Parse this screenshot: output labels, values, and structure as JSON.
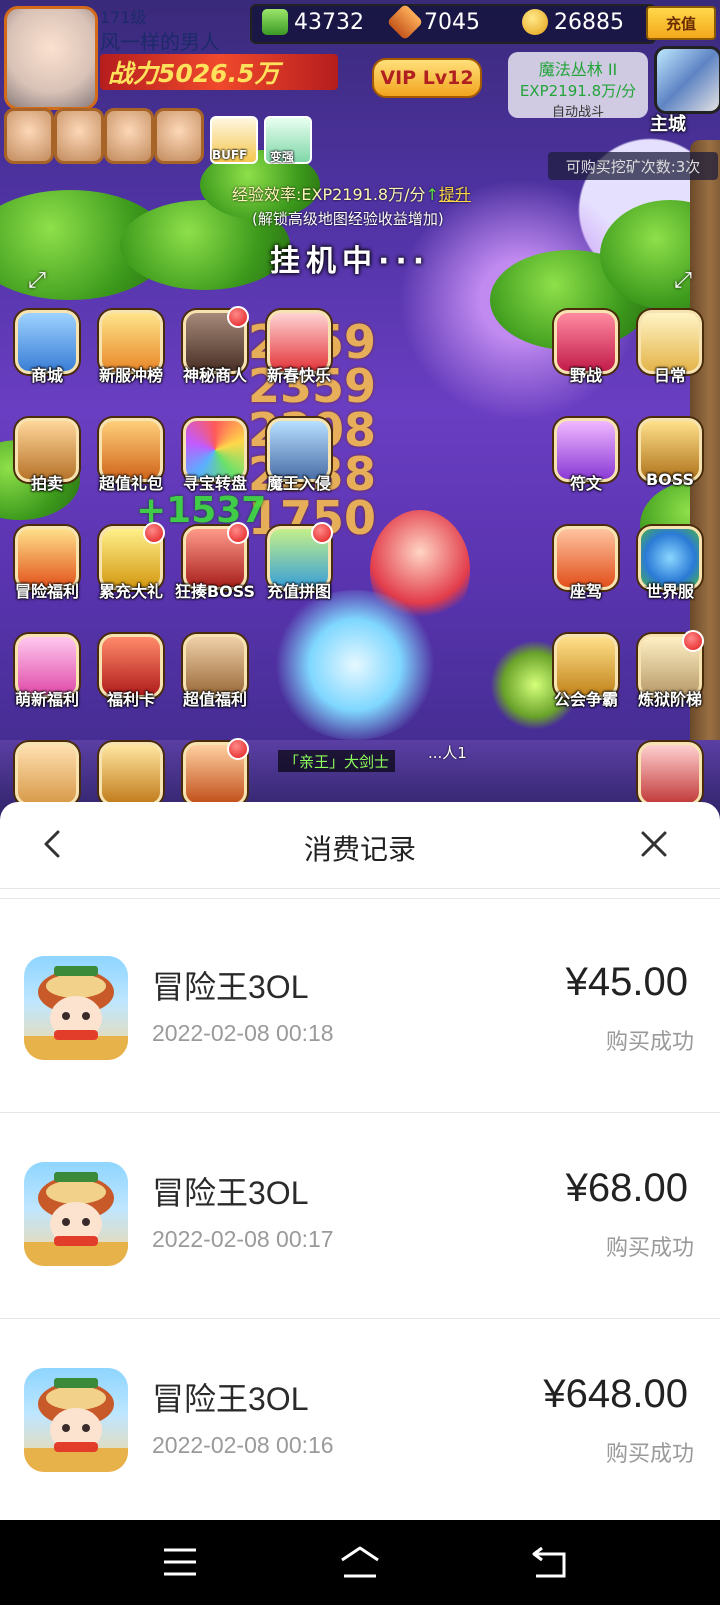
{
  "game": {
    "currency": {
      "cash": "43732",
      "badge": "7045",
      "coins": "26885",
      "recharge_label": "充值"
    },
    "player": {
      "level": "171级",
      "name": "风一样的男人",
      "power": "战力5026.5万",
      "vip": "VIP Lv12"
    },
    "zone": {
      "name": "魔法丛林 II",
      "exp_rate": "EXP2191.8万/分",
      "mode": "自动战斗"
    },
    "main_city_label": "主城",
    "mining_text": "可购买挖矿次数:3次",
    "shortcut_labels": {
      "buff": "BUFF",
      "upgrade": "变强"
    },
    "exp_efficiency": "经验效率:EXP2191.8万/分",
    "exp_boost_label": "提升",
    "unlock_hint": "(解锁高级地图经验收益增加)",
    "idle_text": "挂机中···",
    "icons_left": [
      {
        "label": "商城"
      },
      {
        "label": "新服冲榜"
      },
      {
        "label": "神秘商人"
      },
      {
        "label": "新春快乐"
      },
      {
        "label": "拍卖"
      },
      {
        "label": "超值礼包"
      },
      {
        "label": "寻宝转盘"
      },
      {
        "label": "魔王入侵"
      },
      {
        "label": "冒险福利"
      },
      {
        "label": "累充大礼"
      },
      {
        "label": "狂揍BOSS"
      },
      {
        "label": "充值拼图"
      },
      {
        "label": "萌新福利"
      },
      {
        "label": "福利卡"
      },
      {
        "label": "超值福利"
      }
    ],
    "icons_right": [
      {
        "label": "野战"
      },
      {
        "label": "日常"
      },
      {
        "label": "符文"
      },
      {
        "label": "BOSS"
      },
      {
        "label": "座驾"
      },
      {
        "label": "世界服"
      },
      {
        "label": "公会争霸"
      },
      {
        "label": "炼狱阶梯"
      }
    ],
    "damage_numbers": [
      "2359",
      "2359",
      "2208",
      "2338",
      "1750"
    ],
    "heal_number": "+1537",
    "char_name": "「亲王」大剑士",
    "char_name2": "...人1"
  },
  "sheet": {
    "title": "消费记录",
    "records": [
      {
        "app": "冒险王3OL",
        "time": "2022-02-08 00:18",
        "amount": "¥45.00",
        "status": "购买成功"
      },
      {
        "app": "冒险王3OL",
        "time": "2022-02-08 00:17",
        "amount": "¥68.00",
        "status": "购买成功"
      },
      {
        "app": "冒险王3OL",
        "time": "2022-02-08 00:16",
        "amount": "¥648.00",
        "status": "购买成功"
      }
    ]
  },
  "icons": {
    "back": "chevron-left-icon",
    "close": "close-icon",
    "nav_menu": "menu-icon",
    "nav_home": "home-icon",
    "nav_back": "back-icon"
  }
}
